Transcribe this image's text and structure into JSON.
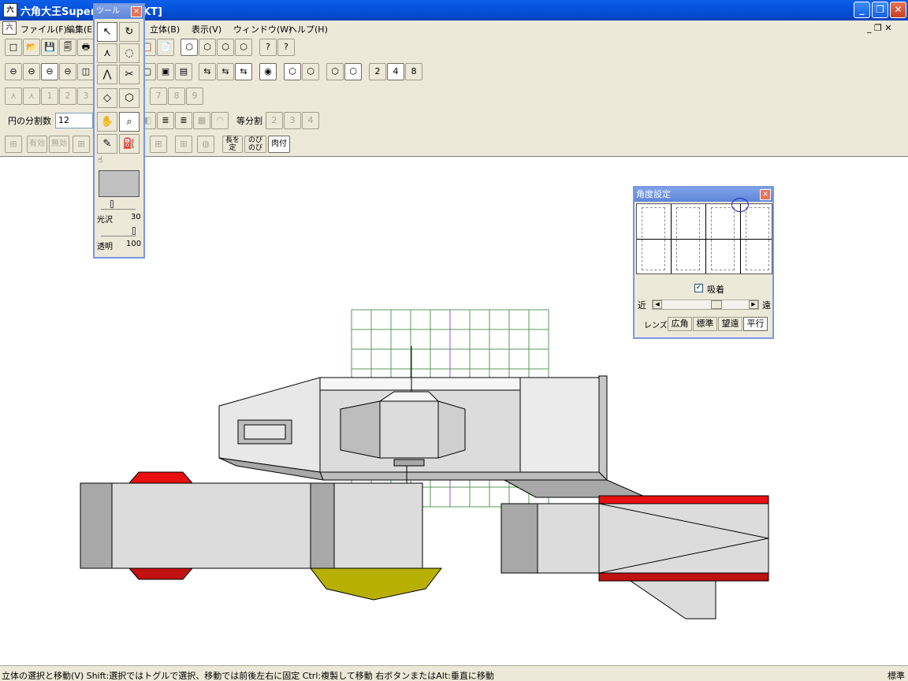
{
  "window": {
    "title": "六角大王Super",
    "title_suffix": "[KT]",
    "app_icon": "六",
    "minimize": "_",
    "restore": "❐",
    "close": "✕"
  },
  "menu": {
    "items": [
      "ファイル(F)",
      "編集(E)",
      "立体(B)",
      "表示(V)",
      "ウィンドウ(W)",
      "ヘルプ(H)"
    ],
    "mdi_controls": "_  ❐  ✕"
  },
  "toolbar1": {
    "buttons": [
      "□",
      "📂",
      "💾",
      "🗐",
      "🖶",
      "📋",
      "📄",
      "⬡",
      "⬡",
      "⬡",
      "⬡",
      "?",
      "?"
    ]
  },
  "toolbar2": {
    "shape_buttons": [
      "⊖",
      "⊖",
      "⊖",
      "⊖"
    ],
    "numbers": [
      "2",
      "4",
      "8"
    ]
  },
  "toolbar3": {
    "numbers_left": [
      "1",
      "2",
      "3"
    ],
    "numbers_right": [
      "7",
      "8",
      "9"
    ]
  },
  "toolbar4": {
    "circle_division_label": "円の分割数",
    "circle_division_value": "12",
    "equal_division_label": "等分割",
    "numbers": [
      "2",
      "3",
      "4"
    ]
  },
  "toolbar5": {
    "valid_label": "有効",
    "invalid_label": "無効",
    "fixed_length_label": "長を定",
    "stretch_label": "のびのび",
    "flesh_label": "肉付"
  },
  "tool_palette": {
    "title": "ツール",
    "close": "✕",
    "gloss_label": "光沢",
    "gloss_value": "30",
    "transparency_label": "透明",
    "transparency_value": "100",
    "swatch_color": "#c0c0c0",
    "gloss_level": 0.3,
    "transparency_level": 1.0
  },
  "angle_panel": {
    "title": "角度設定",
    "close": "✕",
    "snap_label": "吸着",
    "snap_checked": "✓",
    "near_label": "近",
    "far_label": "遠",
    "lens_label": "レンズ",
    "lens_buttons": [
      "広角",
      "標準",
      "望遠",
      "平行"
    ],
    "selected_lens": "平行"
  },
  "status": {
    "hint": "立体の選択と移動(V)   Shift:選択ではトグルで選択、移動では前後左右に固定   Ctrl:複製して移動   右ボタンまたはAlt:垂直に移動",
    "mode": "標準"
  }
}
